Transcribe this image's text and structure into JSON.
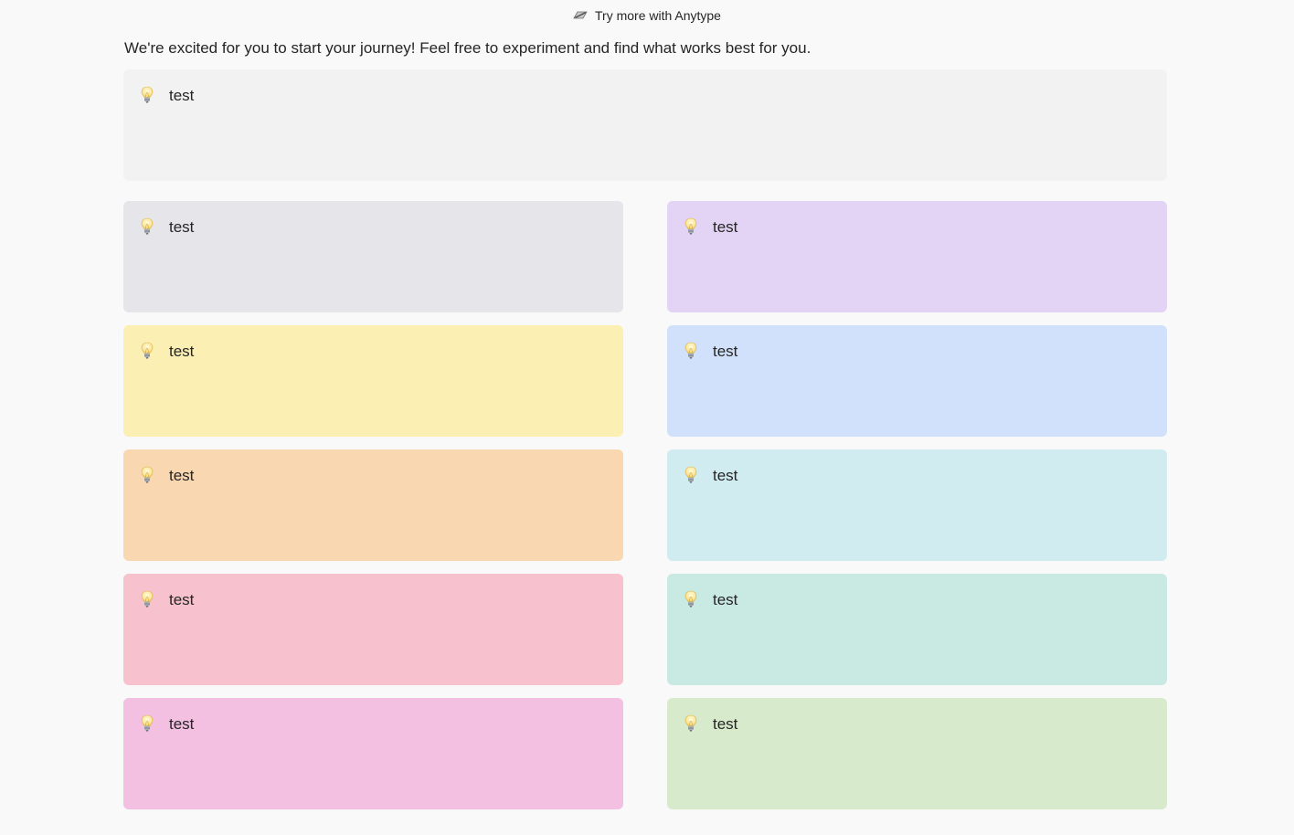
{
  "header": {
    "icon": "anytype-leaf-icon",
    "link_text": "Try more with Anytype"
  },
  "intro_text": "We're excited for you to start your journey! Feel free to experiment and find what works best for you.",
  "callouts": [
    {
      "icon": "lightbulb-icon",
      "text": "test",
      "color": "#f2f2f2"
    },
    {
      "icon": "lightbulb-icon",
      "text": "test",
      "color": "#e6e5ea"
    },
    {
      "icon": "lightbulb-icon",
      "text": "test",
      "color": "#e3d3f5"
    },
    {
      "icon": "lightbulb-icon",
      "text": "test",
      "color": "#fbefb4"
    },
    {
      "icon": "lightbulb-icon",
      "text": "test",
      "color": "#d1e1fb"
    },
    {
      "icon": "lightbulb-icon",
      "text": "test",
      "color": "#f9d7b1"
    },
    {
      "icon": "lightbulb-icon",
      "text": "test",
      "color": "#d0ecf0"
    },
    {
      "icon": "lightbulb-icon",
      "text": "test",
      "color": "#f7c2cd"
    },
    {
      "icon": "lightbulb-icon",
      "text": "test",
      "color": "#c8eae2"
    },
    {
      "icon": "lightbulb-icon",
      "text": "test",
      "color": "#f3c0e2"
    },
    {
      "icon": "lightbulb-icon",
      "text": "test",
      "color": "#d7eacb"
    }
  ]
}
